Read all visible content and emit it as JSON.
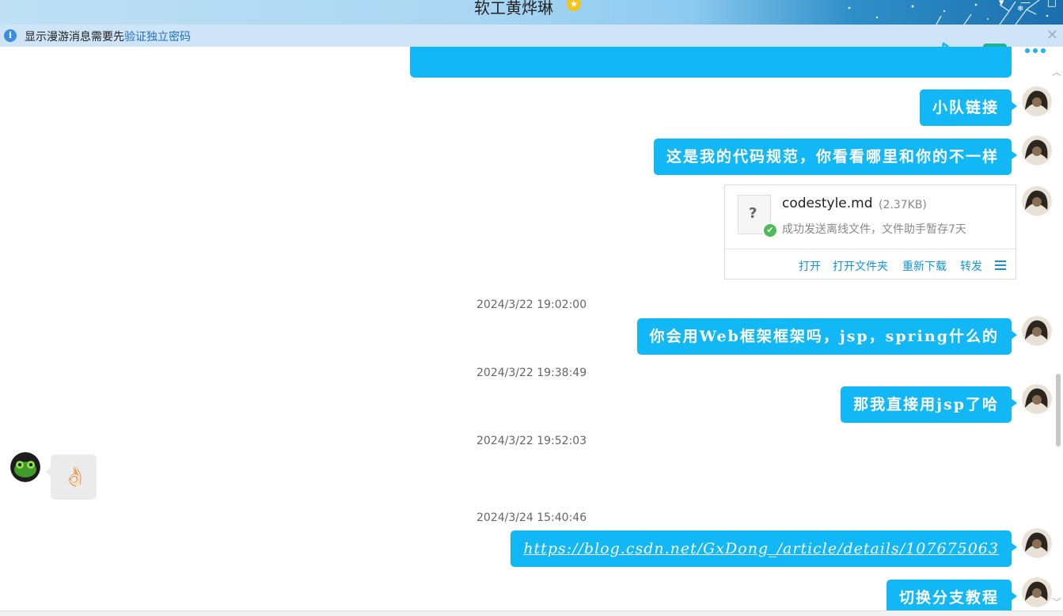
{
  "window": {
    "title": "软工黄烨琳",
    "title_badge": "★",
    "controls": [
      "▾",
      "—",
      "□"
    ]
  },
  "notice": {
    "info_icon": "i",
    "text_prefix": "显示漫游消息需要先",
    "link": "验证独立密码",
    "close": "✕"
  },
  "toolbar": {
    "icons": [
      "phone-icon",
      "video-icon",
      "more-icon"
    ]
  },
  "messages": [
    {
      "id": "m1",
      "type": "text",
      "sender": "self",
      "text": "小队链接"
    },
    {
      "id": "m2",
      "type": "text",
      "sender": "self",
      "text": "这是我的代码规范，你看看哪里和你的不一样"
    },
    {
      "id": "m3",
      "type": "file",
      "sender": "self",
      "file_name": "codestyle.md",
      "file_size": "(2.37KB)",
      "status": "成功发送离线文件，文件助手暂存7天",
      "thumb_glyph": "?",
      "ok_glyph": "✔",
      "actions": [
        "打开",
        "打开文件夹",
        "重新下载",
        "转发"
      ]
    },
    {
      "id": "t1",
      "type": "timestamp",
      "text": "2024/3/22 19:02:00"
    },
    {
      "id": "m4",
      "type": "text",
      "sender": "self",
      "text": "你会用Web框架框架吗，jsp，spring什么的"
    },
    {
      "id": "t2",
      "type": "timestamp",
      "text": "2024/3/22 19:38:49"
    },
    {
      "id": "m5",
      "type": "text",
      "sender": "self",
      "text": "那我直接用jsp了哈"
    },
    {
      "id": "t3",
      "type": "timestamp",
      "text": "2024/3/22 19:52:03"
    },
    {
      "id": "m6",
      "type": "emoji",
      "sender": "other",
      "emoji": "👌🏻"
    },
    {
      "id": "t4",
      "type": "timestamp",
      "text": "2024/3/24 15:40:46"
    },
    {
      "id": "m7",
      "type": "link",
      "sender": "self",
      "text": "https://blog.csdn.net/GxDong_/article/details/107675063"
    },
    {
      "id": "m8",
      "type": "text",
      "sender": "self",
      "text": "切换分支教程"
    }
  ],
  "colors": {
    "bubble": "#12b7f5",
    "link": "#1f6fc8",
    "notice_bg": "#cfe4f7"
  }
}
